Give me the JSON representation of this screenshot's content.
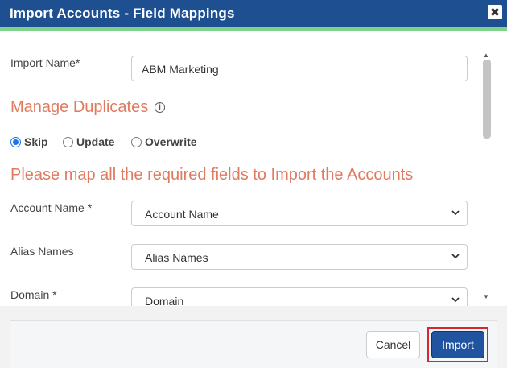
{
  "dialog": {
    "title": "Import Accounts - Field Mappings",
    "close_glyph": "✖"
  },
  "form": {
    "import_name_label": "Import Name*",
    "import_name_value": "ABM Marketing",
    "duplicates_heading": "Manage Duplicates",
    "duplicates_options": [
      {
        "label": "Skip",
        "checked": true
      },
      {
        "label": "Update",
        "checked": false
      },
      {
        "label": "Overwrite",
        "checked": false
      }
    ],
    "mapping_heading": "Please map all the required fields to Import the Accounts",
    "mappings": [
      {
        "label": "Account Name *",
        "value": "Account Name"
      },
      {
        "label": "Alias Names",
        "value": "Alias Names"
      },
      {
        "label": "Domain *",
        "value": "Domain"
      }
    ]
  },
  "footer": {
    "cancel_label": "Cancel",
    "import_label": "Import"
  },
  "colors": {
    "titlebar": "#1d4f91",
    "accent_heading": "#e07a5f",
    "primary_button": "#2053a0",
    "highlight_outline": "#d9262c"
  }
}
